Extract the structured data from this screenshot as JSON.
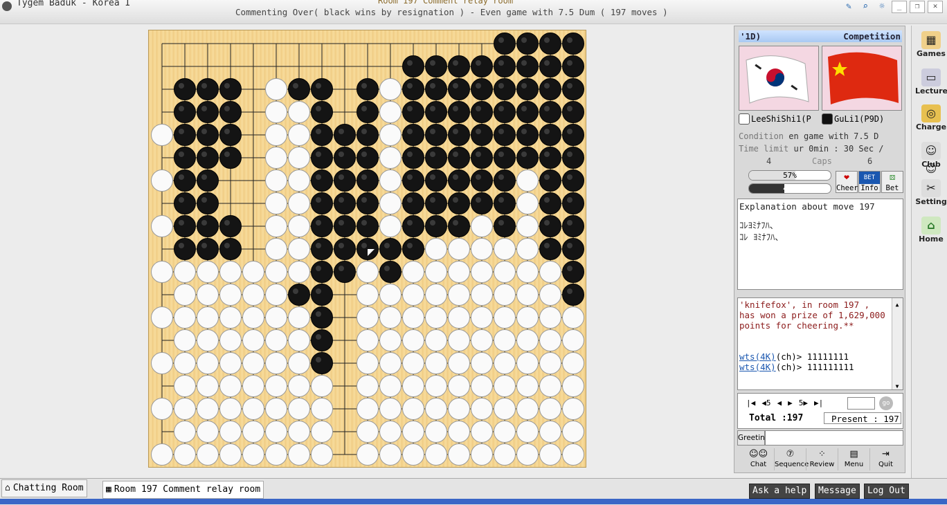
{
  "window": {
    "app_title": "Tygem Baduk - Korea I",
    "room_title": "Room 197 Comment relay room",
    "status_line": "Commenting Over( black wins by resignation ) - Even game with 7.5 Dum  ( 197 moves )"
  },
  "board": {
    "size": 19,
    "last_move": "K10",
    "black": [
      "B10",
      "B11",
      "B12",
      "B13",
      "B14",
      "B15",
      "B16",
      "B17",
      "C10",
      "C11",
      "C12",
      "C13",
      "C14",
      "C15",
      "C16",
      "C17",
      "D10",
      "D11",
      "D14",
      "D15",
      "D16",
      "D17",
      "G8",
      "G17",
      "H5",
      "H6",
      "H7",
      "H8",
      "H9",
      "H10",
      "H11",
      "H12",
      "H13",
      "H14",
      "H15",
      "H16",
      "H17",
      "J9",
      "J10",
      "J11",
      "J12",
      "J13",
      "J14",
      "J15",
      "K10",
      "K11",
      "K12",
      "K13",
      "K14",
      "K15",
      "K16",
      "K17",
      "L9",
      "L10",
      "M10",
      "M11",
      "M12",
      "M13",
      "M14",
      "M15",
      "M16",
      "M17",
      "M18",
      "N11",
      "N12",
      "N13",
      "N14",
      "N15",
      "N16",
      "N17",
      "N18",
      "O11",
      "O12",
      "O13",
      "O14",
      "O15",
      "O16",
      "O17",
      "O18",
      "P12",
      "P13",
      "P14",
      "P15",
      "P16",
      "P17",
      "P18",
      "Q11",
      "Q12",
      "Q13",
      "Q14",
      "Q15",
      "Q16",
      "Q17",
      "Q18",
      "Q19",
      "R14",
      "R15",
      "R16",
      "R17",
      "R18",
      "R19",
      "S10",
      "S11",
      "S12",
      "S13",
      "S14",
      "S15",
      "S16",
      "S17",
      "S18",
      "S19",
      "T8",
      "T9",
      "T10",
      "T11",
      "T12",
      "T13",
      "T14",
      "T15",
      "T16",
      "T17",
      "T18",
      "T19"
    ],
    "white": [
      "A1",
      "A3",
      "A5",
      "A7",
      "A9",
      "A11",
      "A13",
      "A15",
      "B1",
      "B2",
      "B3",
      "B4",
      "B5",
      "B6",
      "B7",
      "B8",
      "B9",
      "C1",
      "C2",
      "C3",
      "C4",
      "C5",
      "C6",
      "C7",
      "C8",
      "C9",
      "D1",
      "D2",
      "D3",
      "D4",
      "D5",
      "D6",
      "D7",
      "D8",
      "D9",
      "E1",
      "E2",
      "E3",
      "E4",
      "E5",
      "E6",
      "E7",
      "E8",
      "E9",
      "F1",
      "F2",
      "F3",
      "F4",
      "F5",
      "F6",
      "F7",
      "F8",
      "F9",
      "F10",
      "F11",
      "F12",
      "F13",
      "F14",
      "F15",
      "F16",
      "F17",
      "G1",
      "G2",
      "G3",
      "G4",
      "G5",
      "G6",
      "G7",
      "G9",
      "G10",
      "G11",
      "G12",
      "G13",
      "G14",
      "G15",
      "G16",
      "H1",
      "H2",
      "H3",
      "H4",
      "L11",
      "L12",
      "L13",
      "L14",
      "L15",
      "L16",
      "L17",
      "K1",
      "K2",
      "K3",
      "K4",
      "K5",
      "K6",
      "K7",
      "K8",
      "K9",
      "L1",
      "L2",
      "L3",
      "L4",
      "L5",
      "L6",
      "L7",
      "L8",
      "M1",
      "M2",
      "M3",
      "M4",
      "M5",
      "M6",
      "M7",
      "M8",
      "M9",
      "N1",
      "N2",
      "N3",
      "N4",
      "N5",
      "N6",
      "N7",
      "N8",
      "N9",
      "N10",
      "O1",
      "O2",
      "O3",
      "O4",
      "O5",
      "O6",
      "O7",
      "O8",
      "O9",
      "O10",
      "P1",
      "P2",
      "P3",
      "P4",
      "P5",
      "P6",
      "P7",
      "P8",
      "P9",
      "P10",
      "P11",
      "Q1",
      "Q2",
      "Q3",
      "Q4",
      "Q5",
      "Q6",
      "Q7",
      "Q8",
      "Q9",
      "Q10",
      "R1",
      "R2",
      "R3",
      "R4",
      "R5",
      "R6",
      "R7",
      "R8",
      "R9",
      "R10",
      "R11",
      "R12",
      "R13",
      "S1",
      "S2",
      "S3",
      "S4",
      "S5",
      "S6",
      "S7",
      "S8",
      "S9",
      "T1",
      "T2",
      "T3",
      "T4",
      "T5",
      "T6",
      "T7"
    ]
  },
  "panel": {
    "header_left": "'1D)",
    "header_right": "Competition",
    "player_white": "LeeShiShi1(P",
    "player_black": "GuLi1(P9D)",
    "condition_label": "Condition",
    "condition_value": "en game with 7.5 D",
    "timelimit_label": "Time limit",
    "timelimit_value": "ur 0min : 30 Sec /",
    "caps_white": "4",
    "caps_label": "Caps",
    "caps_black": "6",
    "white_pct_label": "57%",
    "white_pct": 57,
    "black_pct_label": "43%",
    "black_pct": 43,
    "buttons": [
      "Cheer",
      "Info",
      "Bet"
    ],
    "explain_title": "Explanation about move 197",
    "explain_line1": "ｺﾚﾖﾐﾅﾌﾊ、",
    "explain_line2": "ｺﾚ ﾖﾐﾅﾌﾊ、",
    "chat_sys": "'knifefox', in room 197 , has won a prize of 1,629,000 points for cheering.**",
    "chat": [
      {
        "user": "wts(4K)",
        "text": "(ch)> 11111111"
      },
      {
        "user": "wts(4K)",
        "text": "(ch)> 111111111"
      }
    ],
    "nav": [
      "|◀",
      "◀5",
      "◀",
      "▶",
      "5▶",
      "▶|"
    ],
    "go_label": "go",
    "total_label": "Total :197",
    "present_label": "Present : 197",
    "greeting_label": "Greeting",
    "bottom_buttons": [
      "Chat",
      "Sequence",
      "Review",
      "Menu",
      "Quit"
    ]
  },
  "sidebar": [
    "Games",
    "Lecture",
    "Charge",
    "Club",
    "Setting",
    "Home"
  ],
  "tabs": {
    "chat_room": "Chatting Room",
    "room": "Room 197 Comment relay room"
  },
  "actions": [
    "Ask a help",
    "Message",
    "Log Out"
  ],
  "colors": {
    "board": "#f5d593",
    "panel_header": "#a9c9f2",
    "sys_text": "#8b1a1a",
    "link": "#1a57b0"
  }
}
